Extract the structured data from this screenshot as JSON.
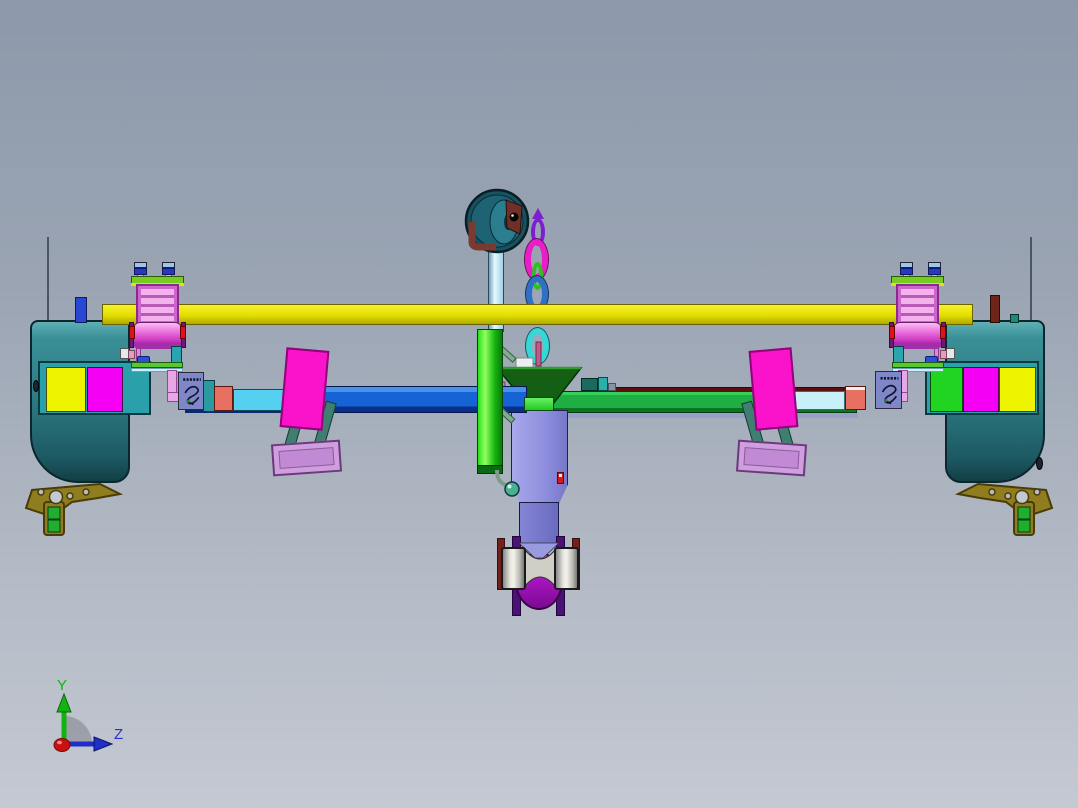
{
  "scene": {
    "type": "cad-3d-viewport",
    "description": "Front orthographic view of a colorful planter / implement CAD assembly",
    "background_top": "#8d99ab",
    "background_bottom": "#c4c9d2"
  },
  "triad": {
    "axis_y_label": "Y",
    "axis_z_label": "Z",
    "axis_y_color": "#0fb60f",
    "axis_z_color": "#2733cc",
    "axis_x_color": "#c81212"
  },
  "parts": [
    {
      "name": "main-cross-beam",
      "color": "#e3de00"
    },
    {
      "name": "left-toolbar-beam",
      "color": "#1663d6"
    },
    {
      "name": "right-toolbar-beam",
      "color": "#1fae43"
    },
    {
      "name": "left-fender",
      "color": "#2f7d86"
    },
    {
      "name": "right-fender",
      "color": "#2f7d86"
    },
    {
      "name": "left-wheel-segments",
      "colors": [
        "#eef400",
        "#f400f4",
        "#29a0aa"
      ]
    },
    {
      "name": "right-wheel-segments",
      "colors": [
        "#21d421",
        "#f400f4",
        "#eef400"
      ]
    },
    {
      "name": "left-linkage-unit",
      "color": "#e87ae0"
    },
    {
      "name": "right-linkage-unit",
      "color": "#e87ae0"
    },
    {
      "name": "left-closing-paddle",
      "color": "#fb13cc"
    },
    {
      "name": "right-closing-paddle",
      "color": "#fb13cc"
    },
    {
      "name": "seed-funnel",
      "color": "#145f13"
    },
    {
      "name": "hydraulic-cylinder",
      "color": "#15b510"
    },
    {
      "name": "top-pulley",
      "color": "#16525f"
    },
    {
      "name": "pulley-fork",
      "color": "#7a3a30"
    },
    {
      "name": "chain-links",
      "colors": [
        "#7d1fd0",
        "#ea1ec8",
        "#2fc01f",
        "#2e6fc8",
        "#35d8d8"
      ]
    },
    {
      "name": "center-housing",
      "color": "#9a9ae0"
    },
    {
      "name": "press-wheel",
      "color": "#a816c0"
    },
    {
      "name": "roller-bearings",
      "color": "#cfcfc6"
    },
    {
      "name": "scraper-brackets",
      "color": "#8f7d1f"
    },
    {
      "name": "mount-trays",
      "color": "#cf9ede"
    },
    {
      "name": "emblem-plates",
      "color": "#8087c8"
    }
  ]
}
